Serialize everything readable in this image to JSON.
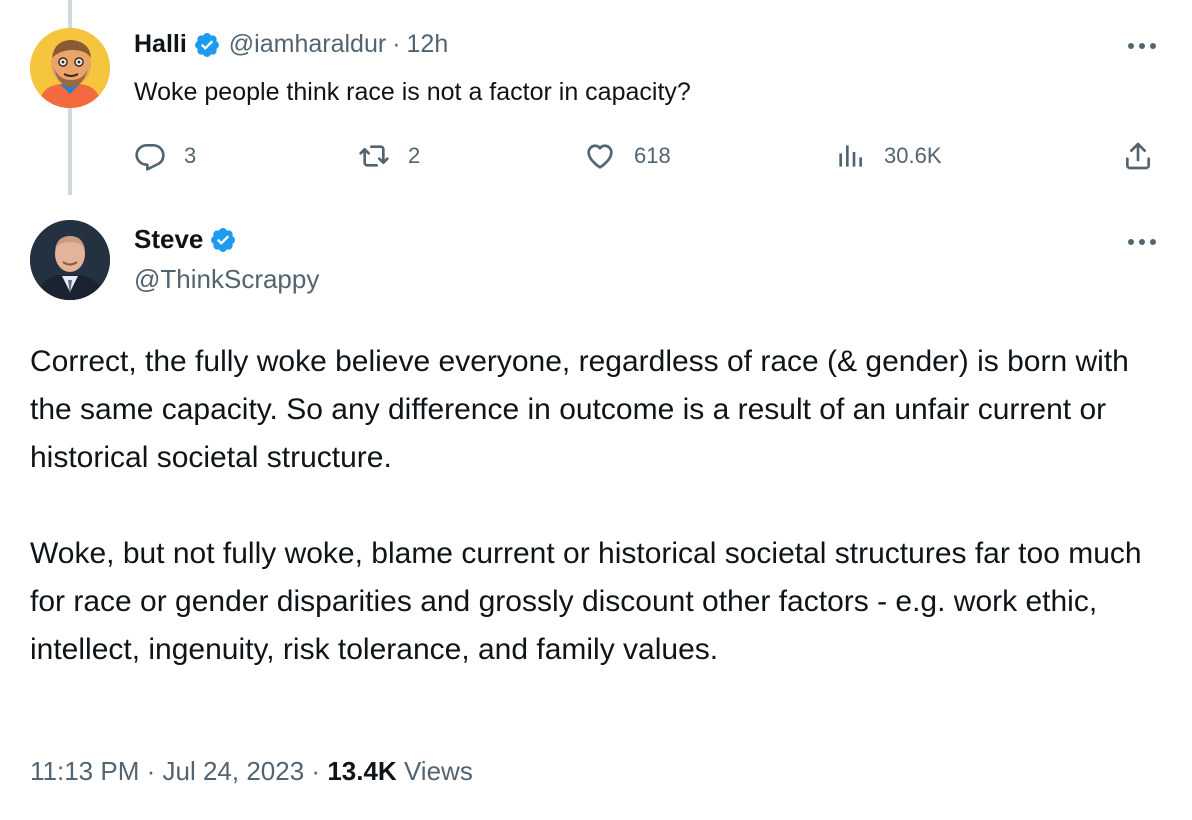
{
  "parent": {
    "name": "Halli",
    "handle": "@iamharaldur",
    "separator": "·",
    "time": "12h",
    "text": "Woke people think race is not a factor in capacity?",
    "actions": {
      "replies": "3",
      "reposts": "2",
      "likes": "618",
      "views": "30.6K"
    }
  },
  "main": {
    "name": "Steve",
    "handle": "@ThinkScrappy",
    "paragraphs": [
      "Correct, the fully woke believe everyone, regardless of race (& gender) is born with the same capacity.  So any difference in outcome is a result of an unfair current or historical societal structure.",
      "Woke, but not fully woke, blame current or historical societal structures far too much for race or gender disparities and grossly discount other factors - e.g. work ethic, intellect, ingenuity, risk tolerance, and family values."
    ],
    "time": "11:13 PM",
    "date": "Jul 24, 2023",
    "separator": "·",
    "views_count": "13.4K",
    "views_label": "Views"
  },
  "colors": {
    "text": "#0f1419",
    "secondary": "#536471",
    "verified": "#1d9bf0",
    "thread_line": "#cfd9de"
  },
  "icons": {
    "reply": "reply-icon",
    "repost": "repost-icon",
    "like": "heart-icon",
    "views": "analytics-icon",
    "share": "share-icon",
    "more": "more-dots-icon",
    "verified": "verified-badge-icon"
  }
}
